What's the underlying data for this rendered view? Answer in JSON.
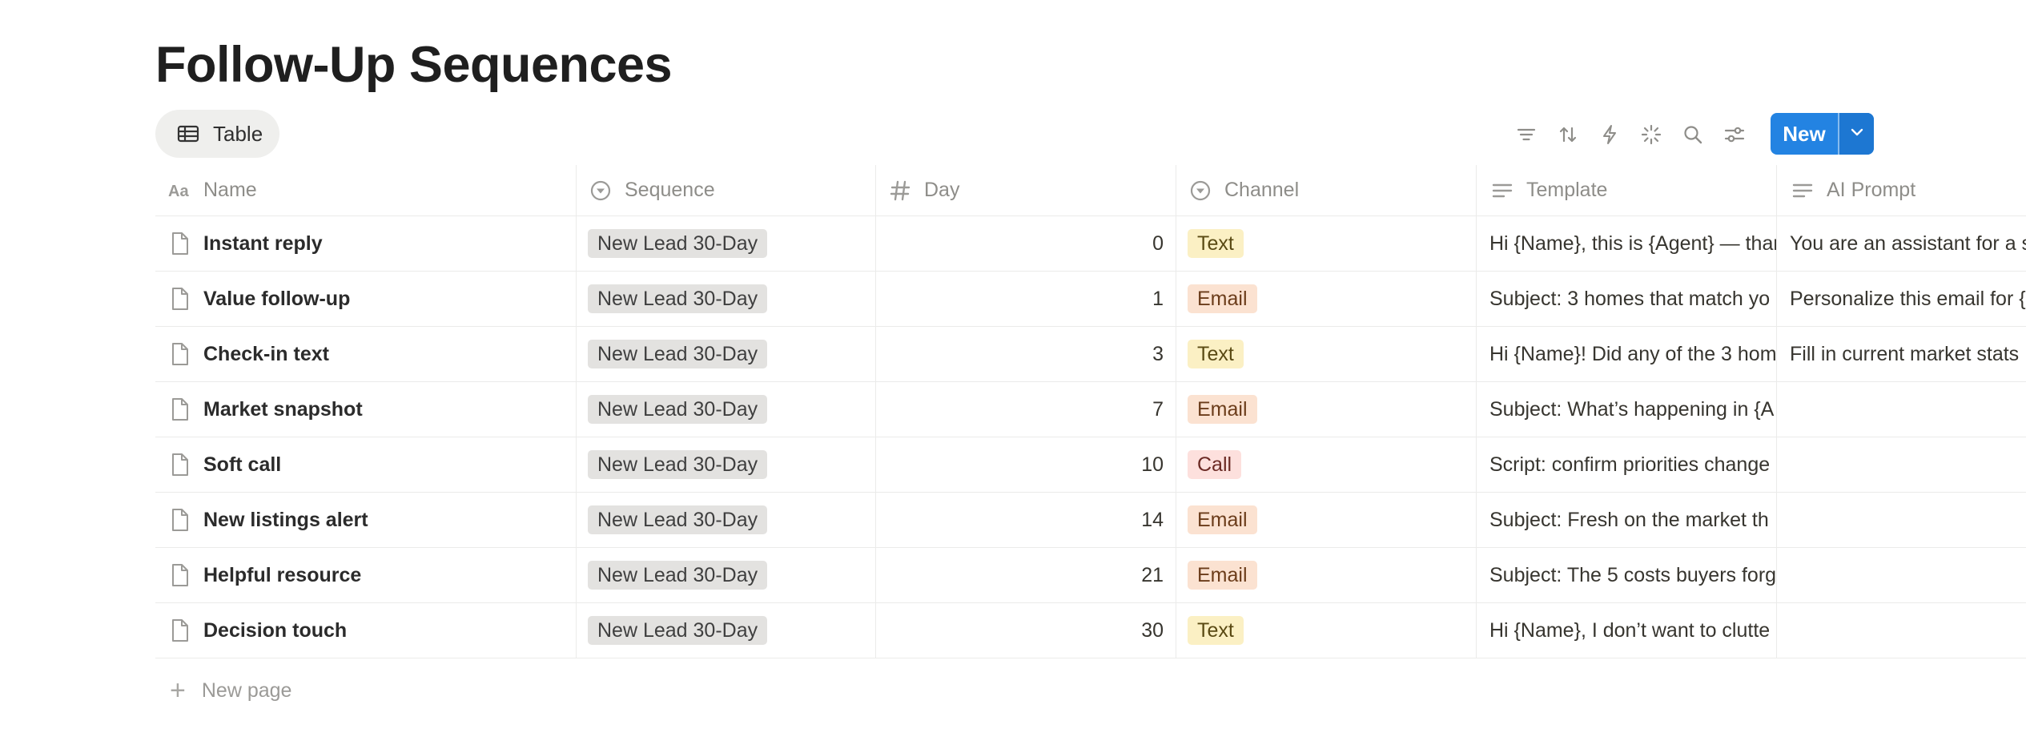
{
  "page": {
    "title": "Follow-Up Sequences"
  },
  "view_tab": {
    "label": "Table",
    "icon": "table-icon"
  },
  "toolbar": {
    "icons": [
      "filter-icon",
      "sort-icon",
      "lightning-icon",
      "sparkle-icon",
      "search-icon",
      "settings-sliders-icon"
    ],
    "new_label": "New",
    "new_dropdown_icon": "chevron-down-icon",
    "accent_color": "#2383e2"
  },
  "columns": [
    {
      "label": "Name",
      "icon": "text-aa-icon"
    },
    {
      "label": "Sequence",
      "icon": "select-icon"
    },
    {
      "label": "Day",
      "icon": "hash-icon"
    },
    {
      "label": "Channel",
      "icon": "select-icon"
    },
    {
      "label": "Template",
      "icon": "text-lines-icon"
    },
    {
      "label": "AI Prompt",
      "icon": "text-lines-icon"
    }
  ],
  "rows": [
    {
      "name": "Instant reply",
      "sequence": "New Lead 30-Day",
      "day": "0",
      "channel": "Text",
      "template": "Hi {Name}, this is {Agent} — thanks for reaching out",
      "ai_prompt": "You are an assistant for a s"
    },
    {
      "name": "Value follow-up",
      "sequence": "New Lead 30-Day",
      "day": "1",
      "channel": "Email",
      "template": "Subject: 3 homes that match yo",
      "ai_prompt": "Personalize this email for {"
    },
    {
      "name": "Check-in text",
      "sequence": "New Lead 30-Day",
      "day": "3",
      "channel": "Text",
      "template": "Hi {Name}! Did any of the 3 hom",
      "ai_prompt": "Fill in current market stats"
    },
    {
      "name": "Market snapshot",
      "sequence": "New Lead 30-Day",
      "day": "7",
      "channel": "Email",
      "template": "Subject: What’s happening in {A",
      "ai_prompt": ""
    },
    {
      "name": "Soft call",
      "sequence": "New Lead 30-Day",
      "day": "10",
      "channel": "Call",
      "template": "Script: confirm priorities change",
      "ai_prompt": ""
    },
    {
      "name": "New listings alert",
      "sequence": "New Lead 30-Day",
      "day": "14",
      "channel": "Email",
      "template": "Subject: Fresh on the market th",
      "ai_prompt": ""
    },
    {
      "name": "Helpful resource",
      "sequence": "New Lead 30-Day",
      "day": "21",
      "channel": "Email",
      "template": "Subject: The 5 costs buyers forg",
      "ai_prompt": ""
    },
    {
      "name": "Decision touch",
      "sequence": "New Lead 30-Day",
      "day": "30",
      "channel": "Text",
      "template": "Hi {Name}, I don’t want to clutte",
      "ai_prompt": ""
    }
  ],
  "channel_colors": {
    "Text": "#fbf0c4",
    "Email": "#fbe2d1",
    "Call": "#fde0dd"
  },
  "footer": {
    "new_page_label": "New page"
  }
}
